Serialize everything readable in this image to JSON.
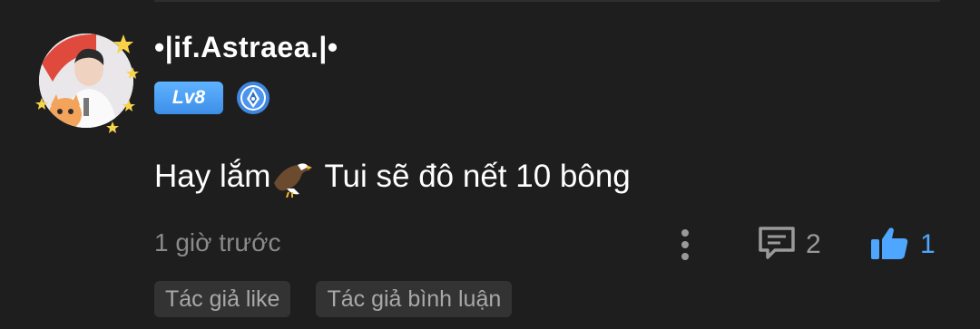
{
  "comment": {
    "username": "•|if.Astraea.|•",
    "level": "Lv8",
    "message_before_emoji": "Hay lắm",
    "emoji": "eagle-icon",
    "message_after_emoji": " Tui sẽ đô nết 10 bông",
    "timestamp": "1 giờ trước",
    "reply_count": "2",
    "like_count": "1",
    "tags": [
      "Tác giả like",
      "Tác giả bình luận"
    ]
  },
  "colors": {
    "background": "#1e1e1e",
    "level_badge": "#4a9cf2",
    "like_accent": "#4ea6ff",
    "muted_text": "#8a8a8a",
    "tag_background": "#333333"
  },
  "icons": [
    "avatar",
    "pen-badge-icon",
    "eagle-icon",
    "more-vertical-icon",
    "reply-icon",
    "thumbs-up-icon"
  ]
}
